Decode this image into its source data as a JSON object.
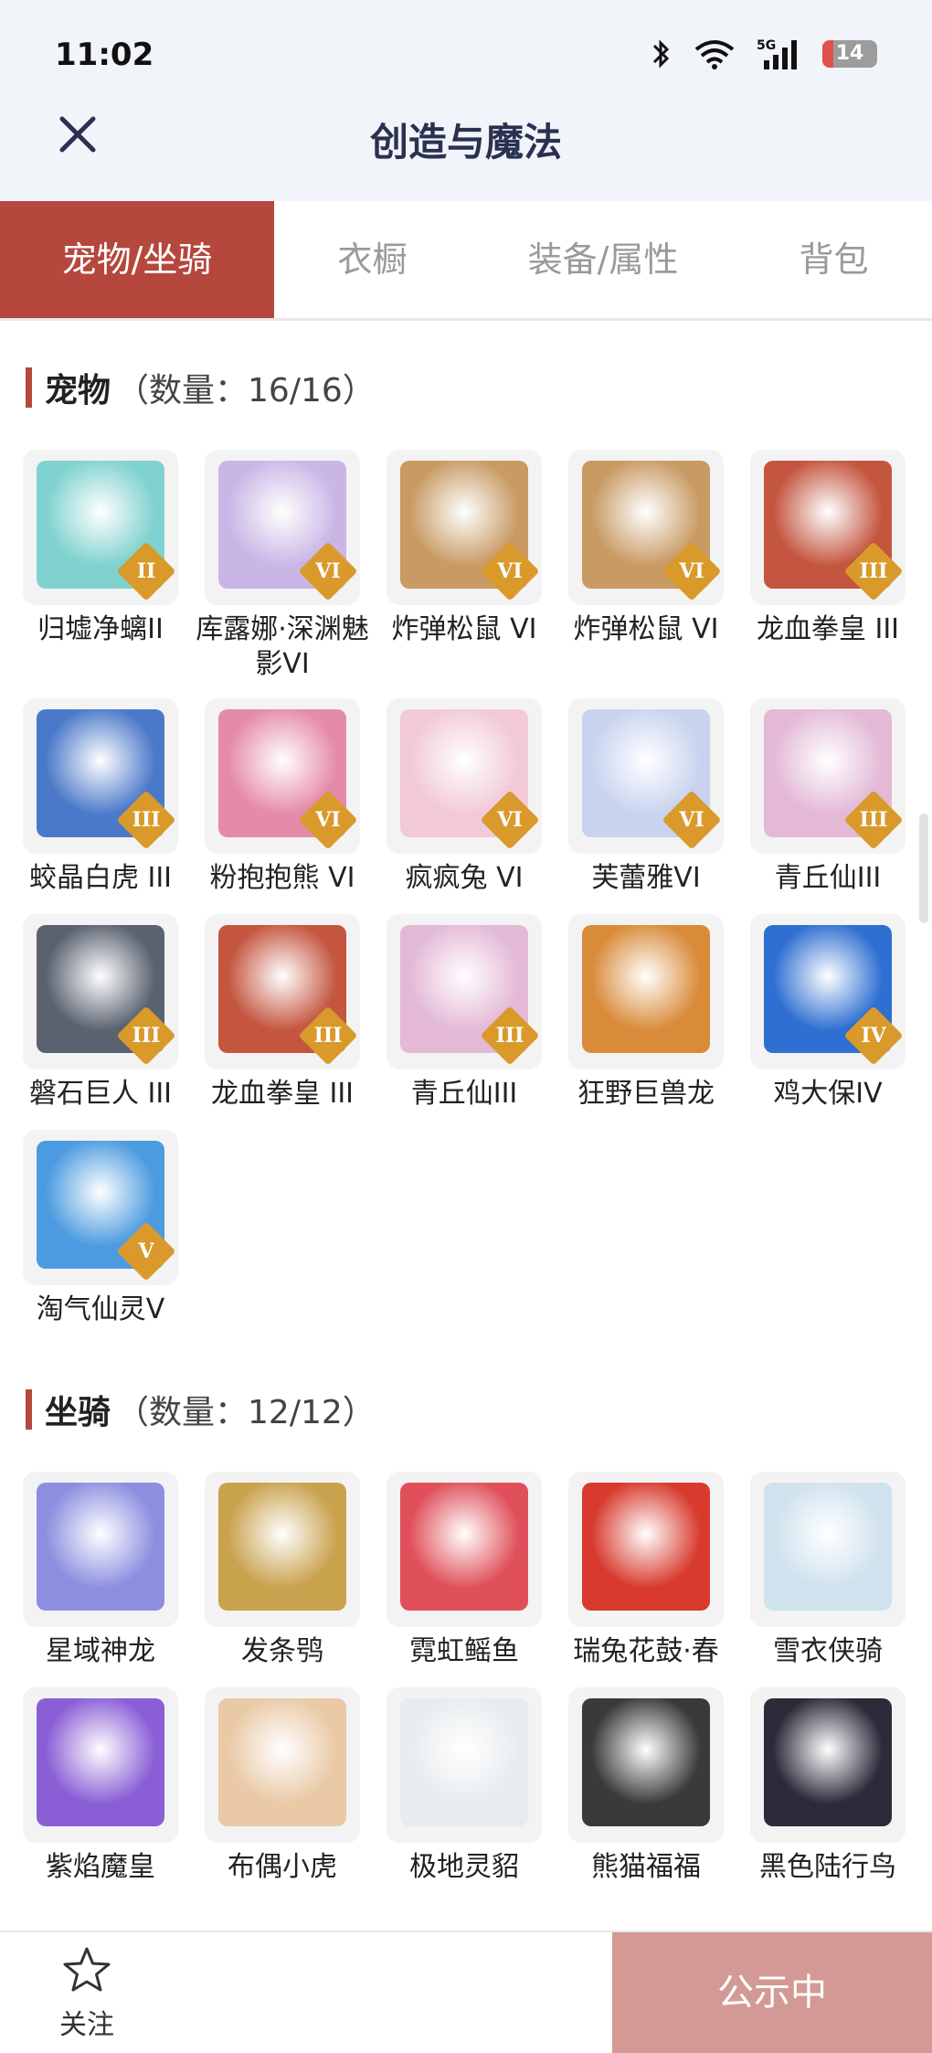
{
  "status": {
    "time": "11:02",
    "network": "5G",
    "battery": "14"
  },
  "header": {
    "title": "创造与魔法"
  },
  "tabs": [
    {
      "label": "宠物/坐骑",
      "active": true
    },
    {
      "label": "衣橱",
      "active": false
    },
    {
      "label": "装备/属性",
      "active": false
    },
    {
      "label": "背包",
      "active": false
    }
  ],
  "pets": {
    "title": "宠物",
    "count": "（数量：16/16）",
    "items": [
      {
        "label": "归墟净螭II",
        "badge": "II",
        "color": "#7fd2cf"
      },
      {
        "label": "库露娜·深渊魅影VI",
        "badge": "VI",
        "color": "#c9b6e6"
      },
      {
        "label": "炸弹松鼠 VI",
        "badge": "VI",
        "color": "#c89a64"
      },
      {
        "label": "炸弹松鼠 VI",
        "badge": "VI",
        "color": "#c89a64"
      },
      {
        "label": "龙血拳皇 III",
        "badge": "III",
        "color": "#c4553f"
      },
      {
        "label": "蛟晶白虎 III",
        "badge": "III",
        "color": "#4b79c9"
      },
      {
        "label": "粉抱抱熊 VI",
        "badge": "VI",
        "color": "#e58aa8"
      },
      {
        "label": "疯疯兔 VI",
        "badge": "VI",
        "color": "#f1c9d8"
      },
      {
        "label": "芙蕾雅VI",
        "badge": "VI",
        "color": "#c8d3ef"
      },
      {
        "label": "青丘仙III",
        "badge": "III",
        "color": "#e3b9d6"
      },
      {
        "label": "磐石巨人 III",
        "badge": "III",
        "color": "#5a6270"
      },
      {
        "label": "龙血拳皇 III",
        "badge": "III",
        "color": "#c4553f"
      },
      {
        "label": "青丘仙III",
        "badge": "III",
        "color": "#e3b9d6"
      },
      {
        "label": "狂野巨兽龙",
        "badge": "",
        "color": "#d98b3a"
      },
      {
        "label": "鸡大保IV",
        "badge": "IV",
        "color": "#2e6fd1"
      },
      {
        "label": "淘气仙灵V",
        "badge": "V",
        "color": "#4c9be0"
      }
    ]
  },
  "mounts": {
    "title": "坐骑",
    "count": "（数量：12/12）",
    "items": [
      {
        "label": "星域神龙",
        "color": "#8c8fe0"
      },
      {
        "label": "发条鸮",
        "color": "#c9a24e"
      },
      {
        "label": "霓虹鳐鱼",
        "color": "#e0505a"
      },
      {
        "label": "瑞兔花鼓·春",
        "color": "#d83a2e"
      },
      {
        "label": "雪衣侠骑",
        "color": "#cfe2ee"
      },
      {
        "label": "紫焰魔皇",
        "color": "#8a5fd6"
      },
      {
        "label": "布偶小虎",
        "color": "#e9c9a6"
      },
      {
        "label": "极地灵貂",
        "color": "#e8ecef"
      },
      {
        "label": "熊猫福福",
        "color": "#3a3a3a"
      },
      {
        "label": "黑色陆行鸟",
        "color": "#2d2a3a"
      }
    ]
  },
  "bottom": {
    "follow": "关注",
    "publish": "公示中"
  }
}
